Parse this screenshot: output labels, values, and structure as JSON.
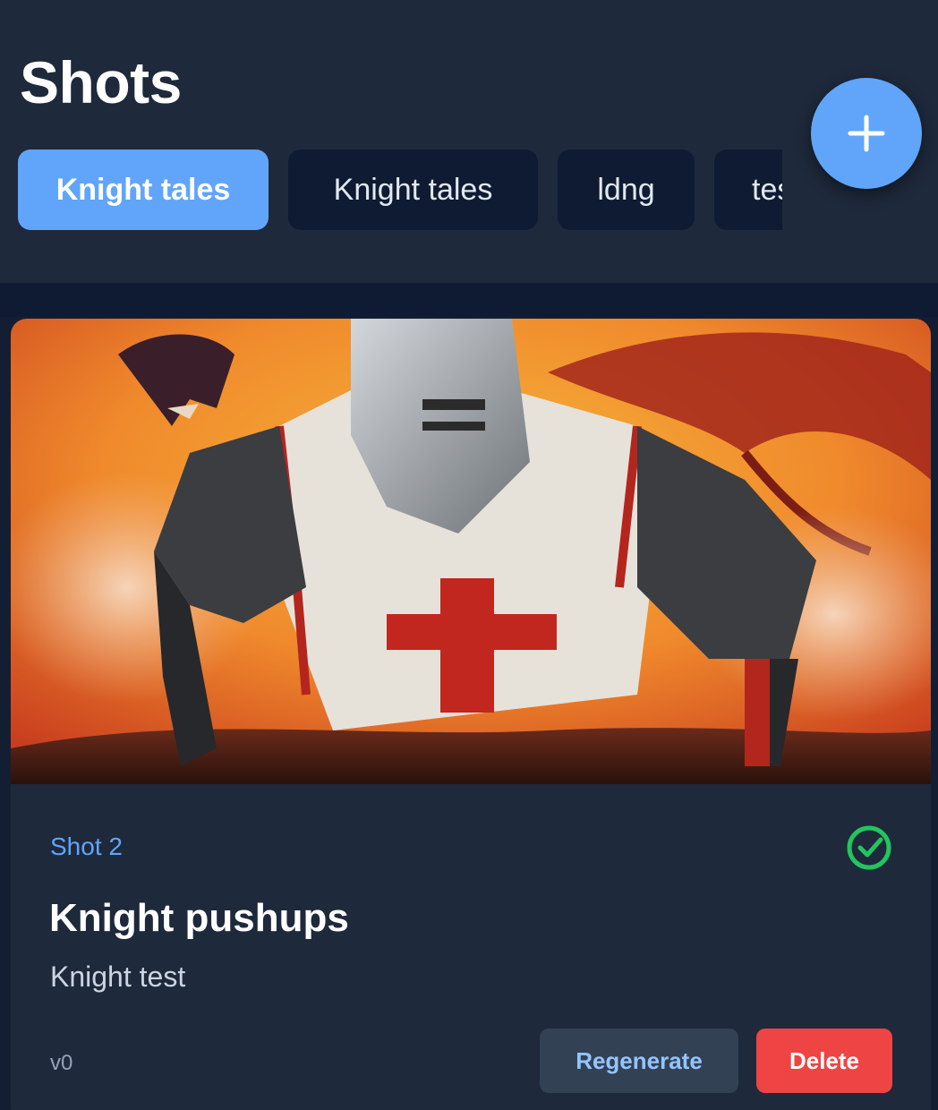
{
  "header": {
    "title": "Shots",
    "add_icon": "plus-icon"
  },
  "tabs": [
    {
      "label": "Knight tales",
      "active": true
    },
    {
      "label": "Knight tales",
      "active": false
    },
    {
      "label": "ldng",
      "active": false
    },
    {
      "label": "tes",
      "active": false
    }
  ],
  "card": {
    "image_description_icon": "knight-dragon-image",
    "shot_label": "Shot 2",
    "status_icon": "check-circle-icon",
    "title": "Knight pushups",
    "description": "Knight test",
    "version": "v0",
    "regenerate_label": "Regenerate",
    "delete_label": "Delete"
  },
  "colors": {
    "accent": "#60a5fa",
    "danger": "#ef4444",
    "success": "#22c55e",
    "background": "#1e293b"
  }
}
